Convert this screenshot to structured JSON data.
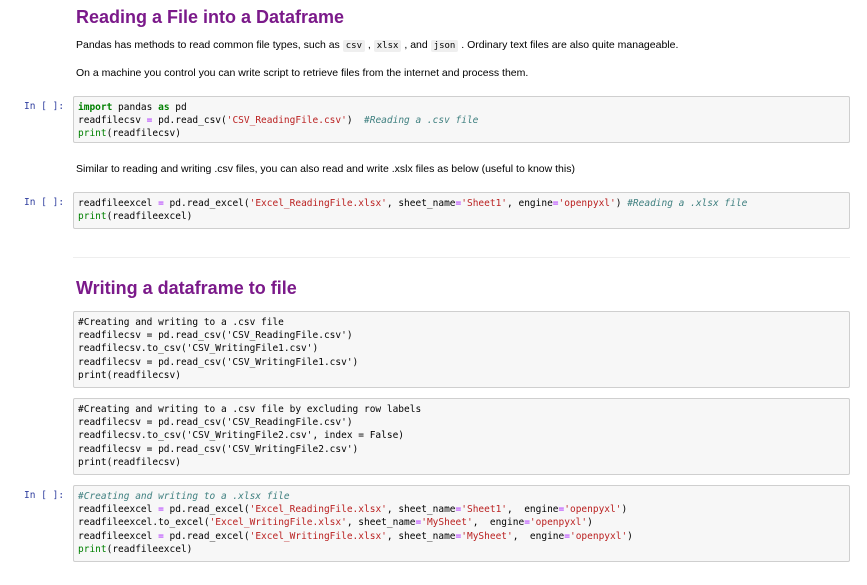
{
  "section1": {
    "heading": "Reading a File into a Dataframe",
    "para1": {
      "before": "Pandas has methods to read common file types, such as ",
      "code1": "csv",
      "mid1": " , ",
      "code2": "xlsx",
      "mid2": " , and ",
      "code3": "json",
      "after": " . Ordinary text files are also quite manageable."
    },
    "para2": "On a machine you control you can write script to retrieve files from the internet and process them.",
    "para3": "Similar to reading and writing .csv files, you can also read and write .xslx files as below (useful to know this)"
  },
  "section2": {
    "heading": "Writing a dataframe to file"
  },
  "prompts": {
    "cell1": "In [ ]:",
    "cell2": "In [ ]:",
    "cell5": "In [ ]:"
  },
  "cells": [
    {
      "name": "code-cell-read-csv",
      "lines": [
        [
          [
            "kw",
            "import"
          ],
          [
            "plain",
            " pandas "
          ],
          [
            "kw",
            "as"
          ],
          [
            "plain",
            " pd"
          ]
        ],
        [
          [
            "plain",
            "readfilecsv "
          ],
          [
            "op",
            "="
          ],
          [
            "plain",
            " pd.read_csv("
          ],
          [
            "str",
            "'CSV_ReadingFile.csv'"
          ],
          [
            "plain",
            ")  "
          ],
          [
            "cm",
            "#Reading a .csv file"
          ]
        ],
        [
          [
            "fn",
            "print"
          ],
          [
            "plain",
            "(readfilecsv)"
          ]
        ]
      ]
    },
    {
      "name": "code-cell-read-excel",
      "lines": [
        [
          [
            "plain",
            "readfileexcel "
          ],
          [
            "op",
            "="
          ],
          [
            "plain",
            " pd.read_excel("
          ],
          [
            "str",
            "'Excel_ReadingFile.xlsx'"
          ],
          [
            "plain",
            ", sheet_name"
          ],
          [
            "op",
            "="
          ],
          [
            "str",
            "'Sheet1'"
          ],
          [
            "plain",
            ", engine"
          ],
          [
            "op",
            "="
          ],
          [
            "str",
            "'openpyxl'"
          ],
          [
            "plain",
            ") "
          ],
          [
            "cm",
            "#Reading a .xlsx file"
          ]
        ],
        [
          [
            "fn",
            "print"
          ],
          [
            "plain",
            "(readfileexcel)"
          ]
        ]
      ]
    },
    {
      "name": "code-cell-write-csv-1",
      "lines": [
        [
          [
            "plain",
            "#Creating and writing to a .csv file"
          ]
        ],
        [
          [
            "plain",
            "readfilecsv = pd.read_csv('CSV_ReadingFile.csv')"
          ]
        ],
        [
          [
            "plain",
            "readfilecsv.to_csv('CSV_WritingFile1.csv')"
          ]
        ],
        [
          [
            "plain",
            "readfilecsv = pd.read_csv('CSV_WritingFile1.csv')"
          ]
        ],
        [
          [
            "plain",
            "print(readfilecsv)"
          ]
        ]
      ]
    },
    {
      "name": "code-cell-write-csv-2",
      "lines": [
        [
          [
            "plain",
            "#Creating and writing to a .csv file by excluding row labels"
          ]
        ],
        [
          [
            "plain",
            "readfilecsv = pd.read_csv('CSV_ReadingFile.csv')"
          ]
        ],
        [
          [
            "plain",
            "readfilecsv.to_csv('CSV_WritingFile2.csv', index = False)"
          ]
        ],
        [
          [
            "plain",
            "readfilecsv = pd.read_csv('CSV_WritingFile2.csv')"
          ]
        ],
        [
          [
            "plain",
            "print(readfilecsv)"
          ]
        ]
      ]
    },
    {
      "name": "code-cell-write-excel",
      "lines": [
        [
          [
            "cm",
            "#Creating and writing to a .xlsx file"
          ]
        ],
        [
          [
            "plain",
            "readfileexcel "
          ],
          [
            "op",
            "="
          ],
          [
            "plain",
            " pd.read_excel("
          ],
          [
            "str",
            "'Excel_ReadingFile.xlsx'"
          ],
          [
            "plain",
            ", sheet_name"
          ],
          [
            "op",
            "="
          ],
          [
            "str",
            "'Sheet1'"
          ],
          [
            "plain",
            ",  engine"
          ],
          [
            "op",
            "="
          ],
          [
            "str",
            "'openpyxl'"
          ],
          [
            "plain",
            ")"
          ]
        ],
        [
          [
            "plain",
            "readfileexcel.to_excel("
          ],
          [
            "str",
            "'Excel_WritingFile.xlsx'"
          ],
          [
            "plain",
            ", sheet_name"
          ],
          [
            "op",
            "="
          ],
          [
            "str",
            "'MySheet'"
          ],
          [
            "plain",
            ",  engine"
          ],
          [
            "op",
            "="
          ],
          [
            "str",
            "'openpyxl'"
          ],
          [
            "plain",
            ")"
          ]
        ],
        [
          [
            "plain",
            "readfileexcel "
          ],
          [
            "op",
            "="
          ],
          [
            "plain",
            " pd.read_excel("
          ],
          [
            "str",
            "'Excel_WritingFile.xlsx'"
          ],
          [
            "plain",
            ", sheet_name"
          ],
          [
            "op",
            "="
          ],
          [
            "str",
            "'MySheet'"
          ],
          [
            "plain",
            ",  engine"
          ],
          [
            "op",
            "="
          ],
          [
            "str",
            "'openpyxl'"
          ],
          [
            "plain",
            ")"
          ]
        ],
        [
          [
            "fn",
            "print"
          ],
          [
            "plain",
            "(readfileexcel)"
          ]
        ]
      ]
    }
  ]
}
